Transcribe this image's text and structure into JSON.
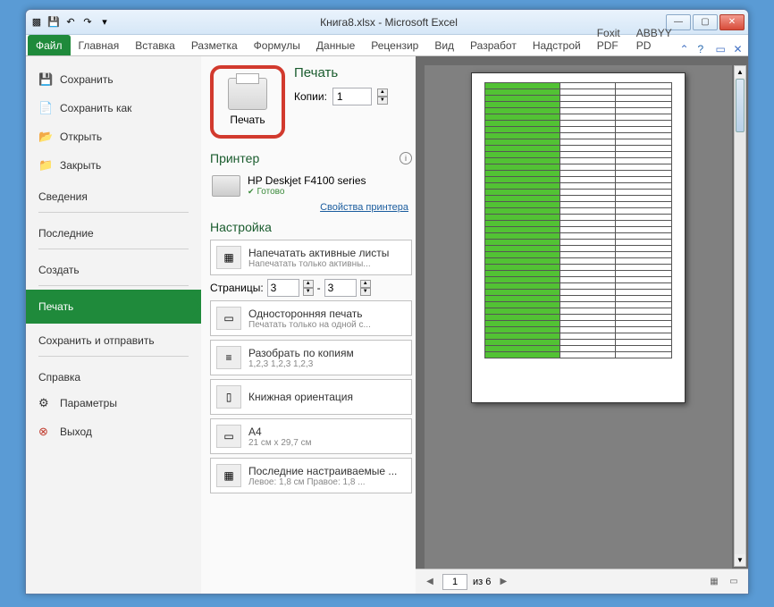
{
  "titlebar": {
    "title": "Книга8.xlsx - Microsoft Excel"
  },
  "qat": {
    "save": "💾",
    "undo": "↶",
    "redo": "↷"
  },
  "wincontrols": {
    "min": "—",
    "max": "▢",
    "close": "✕"
  },
  "ribbon": {
    "tabs": [
      "Файл",
      "Главная",
      "Вставка",
      "Разметка",
      "Формулы",
      "Данные",
      "Рецензир",
      "Вид",
      "Разработ",
      "Надстрой",
      "Foxit PDF",
      "ABBYY PD"
    ],
    "active": 0
  },
  "sidebar": {
    "items": [
      {
        "icon": "💾",
        "label": "Сохранить"
      },
      {
        "icon": "📄",
        "label": "Сохранить как"
      },
      {
        "icon": "📂",
        "label": "Открыть"
      },
      {
        "icon": "📁",
        "label": "Закрыть"
      }
    ],
    "groups": [
      "Сведения",
      "Последние",
      "Создать",
      "Печать",
      "Сохранить и отправить",
      "Справка"
    ],
    "active_group": 3,
    "footer": [
      {
        "icon": "⚙",
        "label": "Параметры"
      },
      {
        "icon": "⊗",
        "label": "Выход"
      }
    ]
  },
  "print": {
    "button_label": "Печать",
    "heading": "Печать",
    "copies_label": "Копии:",
    "copies_value": "1"
  },
  "printer": {
    "section": "Принтер",
    "name": "HP Deskjet F4100 series",
    "status": "Готово",
    "props_link": "Свойства принтера"
  },
  "settings": {
    "section": "Настройка",
    "active_sheets": {
      "t1": "Напечатать активные листы",
      "t2": "Напечатать только активны..."
    },
    "pages_label": "Страницы:",
    "page_from": "3",
    "page_to": "3",
    "page_sep": "-",
    "duplex": {
      "t1": "Односторонняя печать",
      "t2": "Печатать только на одной с..."
    },
    "collate": {
      "t1": "Разобрать по копиям",
      "t2": "1,2,3   1,2,3   1,2,3"
    },
    "orientation": {
      "t1": "Книжная ориентация",
      "t2": ""
    },
    "paper": {
      "t1": "A4",
      "t2": "21 см x 29,7 см"
    },
    "margins": {
      "t1": "Последние настраиваемые ...",
      "t2": "Левое: 1,8 см   Правое: 1,8 ..."
    }
  },
  "preview_nav": {
    "page": "1",
    "total_label": "из 6",
    "prev": "◀",
    "next": "▶"
  }
}
